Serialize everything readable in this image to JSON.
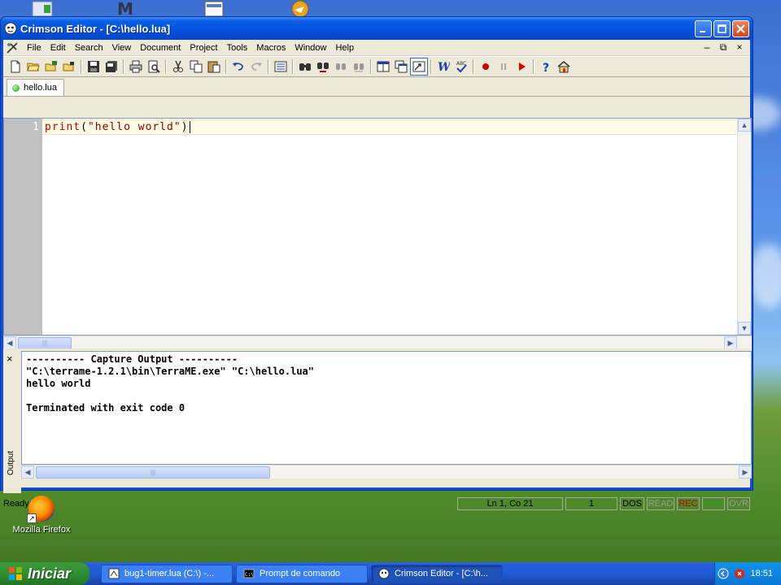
{
  "window": {
    "title": "Crimson Editor - [C:\\hello.lua]"
  },
  "menu": {
    "items": [
      "File",
      "Edit",
      "Search",
      "View",
      "Document",
      "Project",
      "Tools",
      "Macros",
      "Window",
      "Help"
    ]
  },
  "toolbar": {
    "icons": [
      "new-file-icon",
      "open-folder-icon",
      "open-remote-icon",
      "recent-files-icon",
      "save-icon",
      "save-all-icon",
      "print-icon",
      "print-preview-icon",
      "cut-icon",
      "copy-icon",
      "paste-icon",
      "undo-icon",
      "redo-icon",
      "column-mode-icon",
      "find-icon",
      "find-next-icon",
      "replace-icon",
      "goto-icon",
      "window-tile-icon",
      "window-cascade-icon",
      "tool-output-icon",
      "word-wrap-icon",
      "spell-check-icon",
      "record-macro-icon",
      "pause-macro-icon",
      "play-macro-icon",
      "help-icon",
      "home-icon"
    ]
  },
  "tabs": [
    {
      "label": "hello.lua"
    }
  ],
  "editor": {
    "line_number": "1",
    "code_fn": "print",
    "code_open": "(",
    "code_str": "\"hello world\"",
    "code_close": ")"
  },
  "output": {
    "label": "Output",
    "lines": [
      "---------- Capture Output ----------",
      "\"C:\\terrame-1.2.1\\bin\\TerraME.exe\" \"C:\\hello.lua\"",
      "hello world",
      "",
      "Terminated with exit code 0"
    ]
  },
  "status": {
    "text": "Ready",
    "position": "Ln 1, Co 21",
    "column": "1",
    "eol": "DOS",
    "read": "READ",
    "rec": "REC",
    "col": "COL",
    "ovr": "OVR"
  },
  "desktop": {
    "firefox_label": "Mozilla Firefox"
  },
  "taskbar": {
    "start_label": "Iniciar",
    "buttons": [
      {
        "label": "bug1-timer.lua (C:\\) -...",
        "icon": "lua-file-icon"
      },
      {
        "label": "Prompt de comando",
        "icon": "cmd-icon"
      },
      {
        "label": "Crimson Editor - [C:\\h...",
        "icon": "crimson-editor-icon"
      }
    ],
    "clock": "18:51"
  }
}
